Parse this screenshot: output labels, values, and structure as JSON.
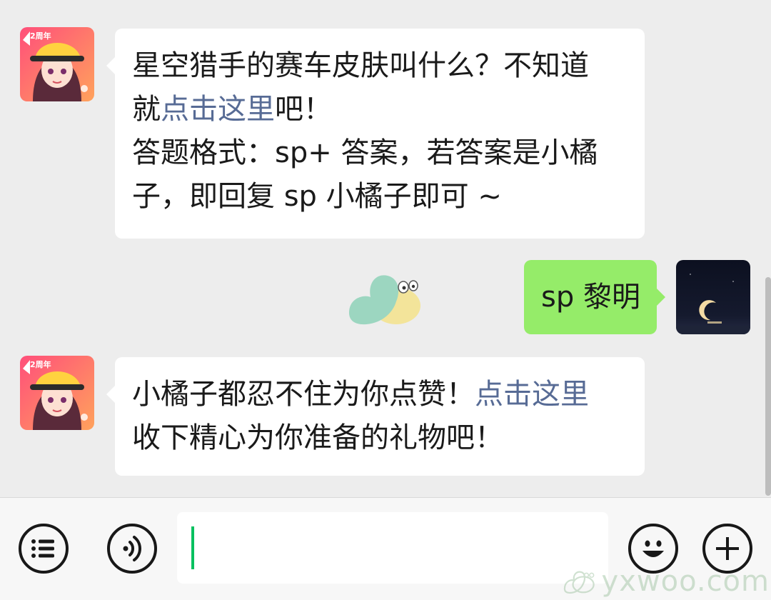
{
  "chat": {
    "messages": [
      {
        "sender": "game-account",
        "direction": "incoming",
        "line1": "星空猎手的赛车皮肤叫什么？不知道",
        "line2_prefix": "就",
        "line2_link": "点击这里",
        "line2_suffix": "吧！",
        "line3": "答题格式：sp+ 答案，若答案是小橘",
        "line4": "子，即回复 sp 小橘子即可 ~"
      },
      {
        "sender": "user",
        "direction": "outgoing",
        "text": "sp 黎明"
      },
      {
        "sender": "game-account",
        "direction": "incoming",
        "line1_prefix": "小橘子都忍不住为你点赞！",
        "line1_link": "点击这里",
        "line2": "收下精心为你准备的礼物吧！"
      }
    ],
    "sticker": "snail-sticker"
  },
  "avatars": {
    "game": {
      "badge_text": "2周年",
      "icon": "game-avatar"
    },
    "user": {
      "icon": "moon-night-avatar"
    }
  },
  "toolbar": {
    "input_value": "",
    "menu_icon": "list-menu-icon",
    "voice_icon": "voice-icon",
    "emoji_icon": "emoji-icon",
    "add_icon": "plus-icon"
  },
  "watermark": {
    "text": "yxwoo.com"
  },
  "colors": {
    "background": "#ededed",
    "incoming_bubble": "#ffffff",
    "outgoing_bubble": "#95ec69",
    "link": "#576b95",
    "caret": "#07c160"
  }
}
